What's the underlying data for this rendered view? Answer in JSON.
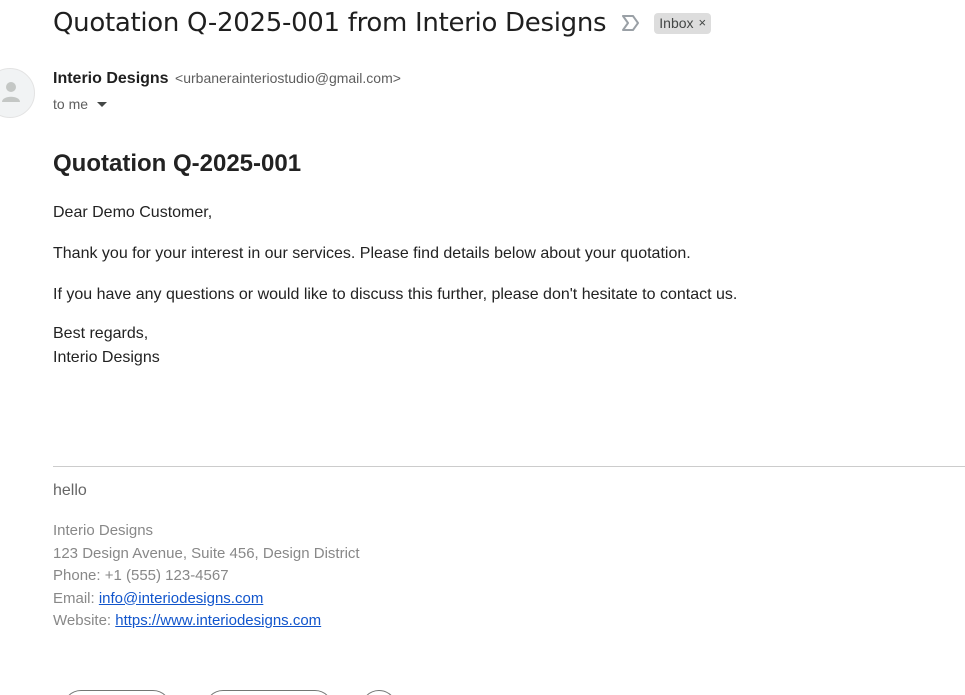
{
  "email": {
    "subject": "Quotation Q-2025-001 from Interio Designs",
    "label": "Inbox",
    "label_remove": "×",
    "sender": {
      "name": "Interio Designs",
      "email": "<urbanerainteriostudio@gmail.com>"
    },
    "recipient": "to me",
    "body": {
      "heading": "Quotation Q-2025-001",
      "greeting": "Dear Demo Customer,",
      "paragraph1": "Thank you for your interest in our services. Please find details below about your quotation.",
      "paragraph2": "If you have any questions or would like to discuss this further, please don't hesitate to contact us.",
      "signoff": "Best regards,",
      "signature": "Interio Designs"
    },
    "footer": {
      "note": "hello",
      "company": "Interio Designs",
      "address": "123 Design Avenue, Suite 456, Design District",
      "phone": "Phone: +1 (555) 123-4567",
      "email_label": "Email: ",
      "email_link": "info@interiodesigns.com",
      "website_label": "Website: ",
      "website_link": "https://www.interiodesigns.com"
    }
  },
  "icons": {
    "important": "important-marker-icon",
    "avatar": "person-icon",
    "recipient_details": "caret-down-icon"
  },
  "colors": {
    "link": "#1155cc",
    "chip_bg": "#dddddd",
    "footer_text": "#888888"
  }
}
